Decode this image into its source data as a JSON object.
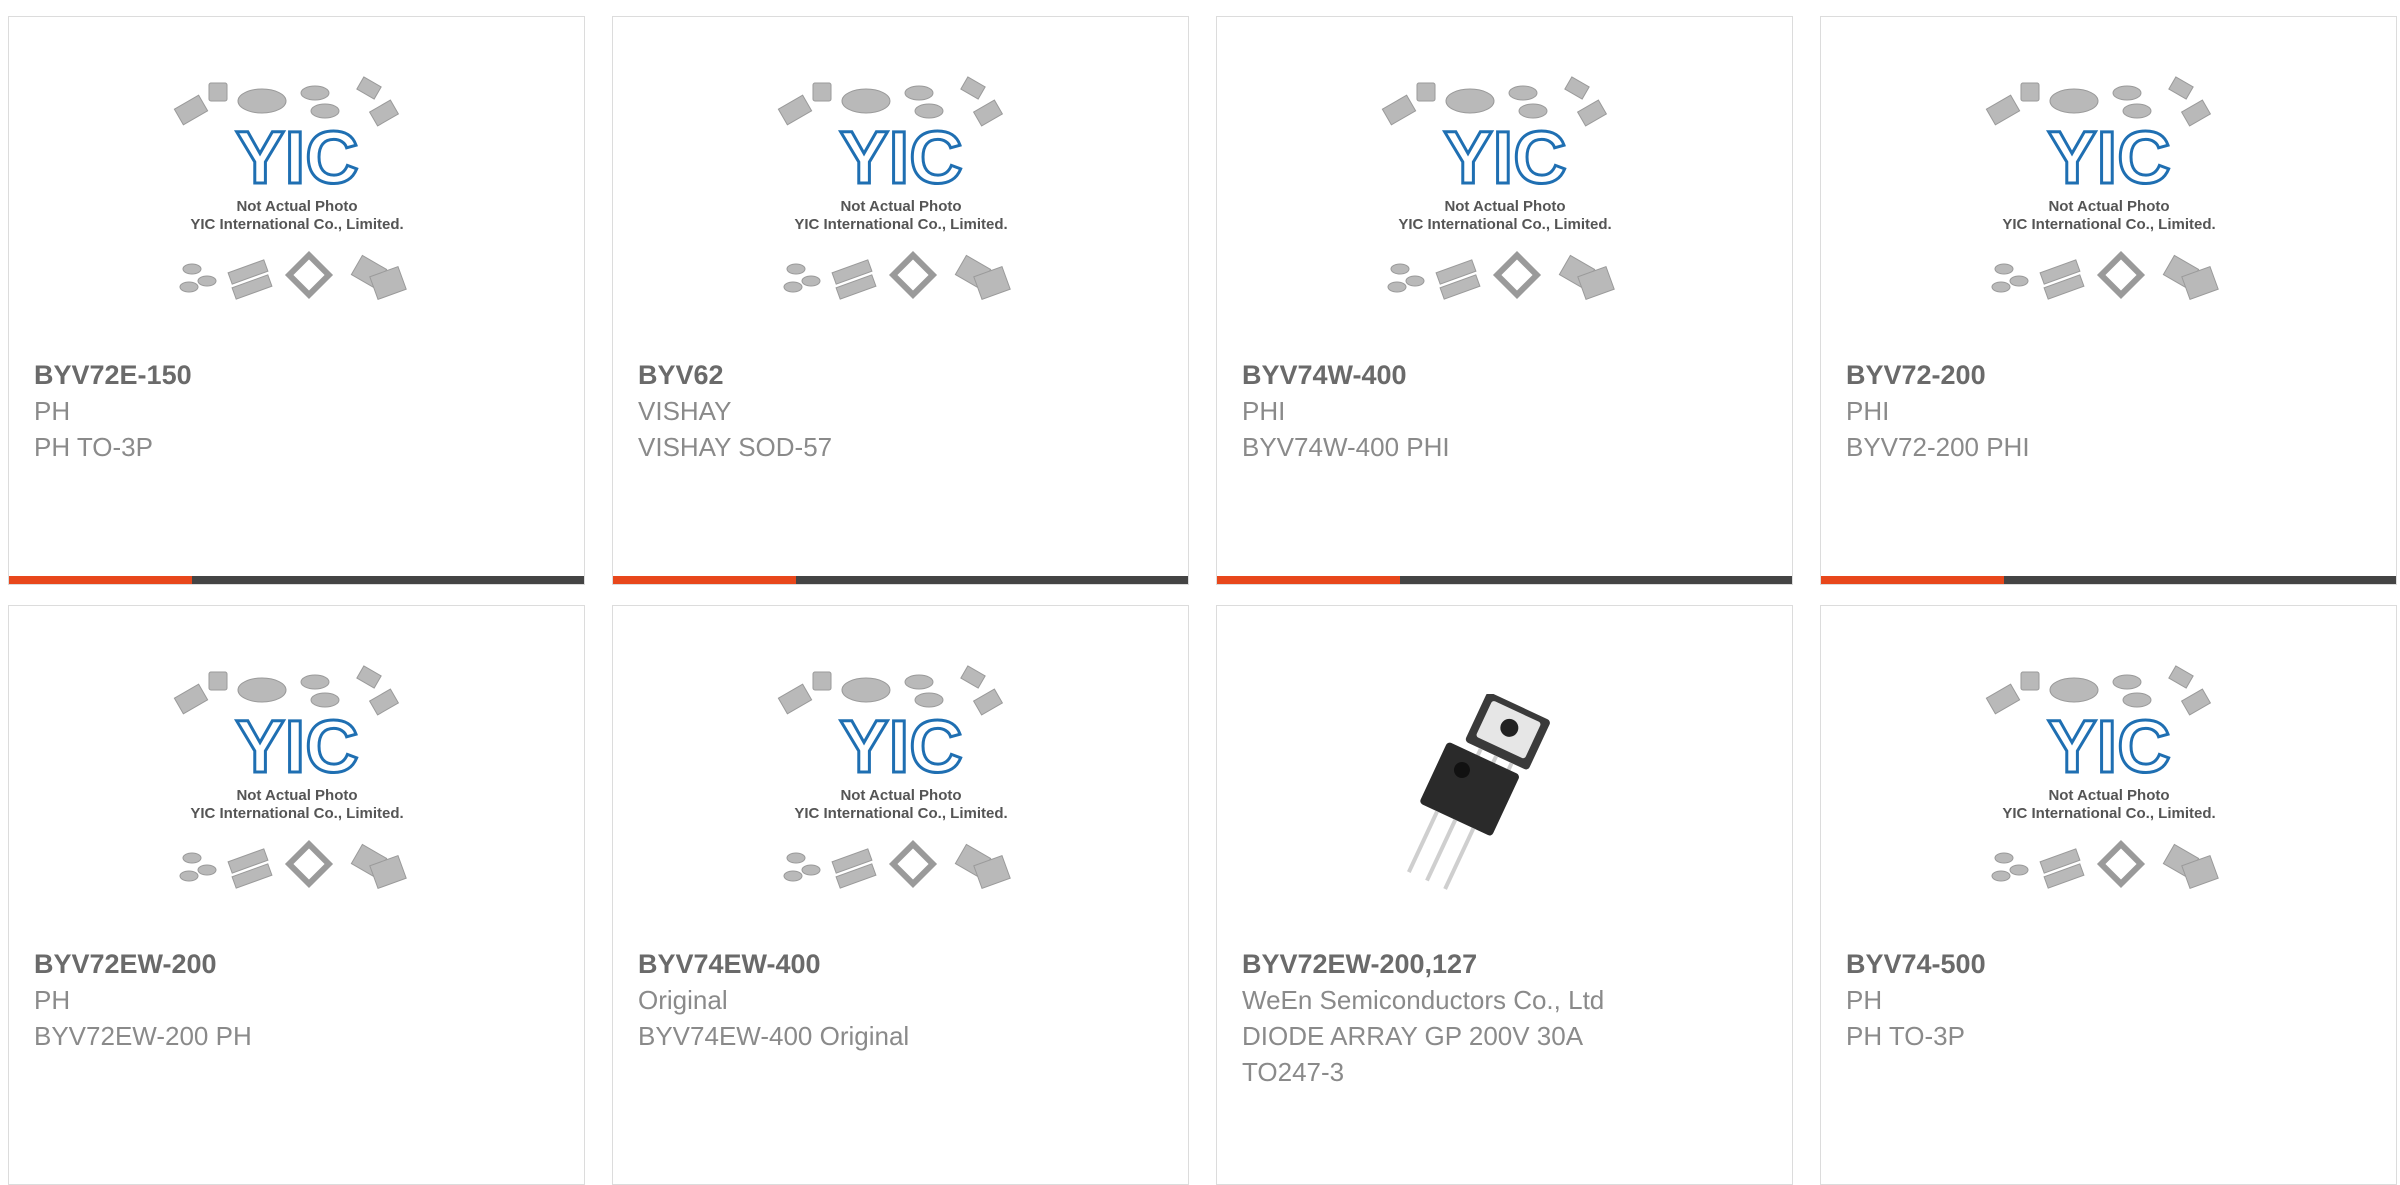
{
  "placeholder": {
    "line1": "Not Actual Photo",
    "line2": "YIC International Co., Limited.",
    "logo_text": "YIC"
  },
  "colors": {
    "accent": "#e8471b",
    "bar": "#444444",
    "logo_blue": "#1f6fb2"
  },
  "products": [
    {
      "part": "BYV72E-150",
      "maker": "PH",
      "desc": "PH TO-3P",
      "image": "placeholder-image"
    },
    {
      "part": "BYV62",
      "maker": "VISHAY",
      "desc": "VISHAY SOD-57",
      "image": "placeholder-image"
    },
    {
      "part": "BYV74W-400",
      "maker": "PHI",
      "desc": "BYV74W-400 PHI",
      "image": "placeholder-image"
    },
    {
      "part": "BYV72-200",
      "maker": "PHI",
      "desc": "BYV72-200 PHI",
      "image": "placeholder-image"
    },
    {
      "part": "BYV72EW-200",
      "maker": "PH",
      "desc": "BYV72EW-200 PH",
      "image": "placeholder-image"
    },
    {
      "part": "BYV74EW-400",
      "maker": "Original",
      "desc": "BYV74EW-400 Original",
      "image": "placeholder-image"
    },
    {
      "part": "BYV72EW-200,127",
      "maker": "WeEn Semiconductors Co., Ltd",
      "desc": "DIODE ARRAY GP 200V 30A",
      "desc2": "TO247-3",
      "image": "to247-photo"
    },
    {
      "part": "BYV74-500",
      "maker": "PH",
      "desc": "PH TO-3P",
      "image": "placeholder-image"
    }
  ]
}
